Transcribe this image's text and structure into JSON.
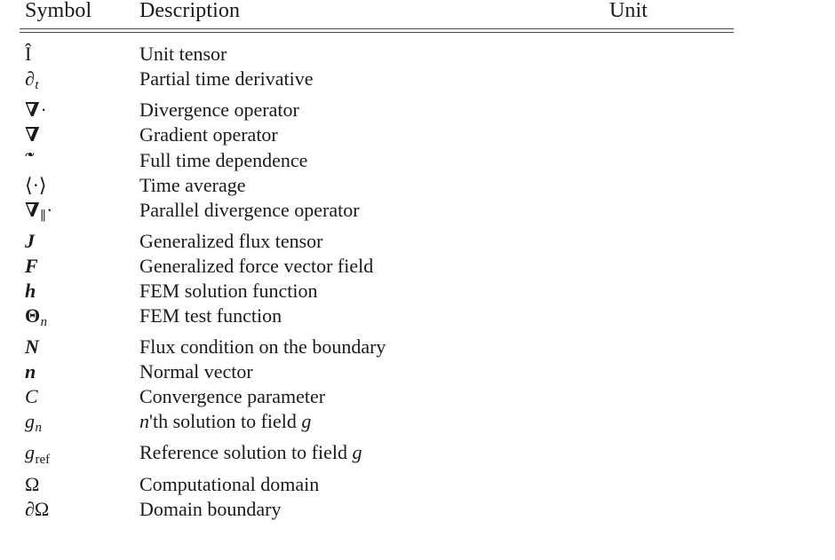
{
  "document": {
    "type": "nomenclature-table",
    "background_color": "#ffffff",
    "text_color": "#1a1a1a",
    "rule_color": "#4a4a4a"
  },
  "table": {
    "headers": {
      "symbol": "Symbol",
      "description": "Description",
      "unit": "Unit"
    },
    "rows": [
      {
        "symbol_text": "Î",
        "description": "Unit tensor",
        "unit": ""
      },
      {
        "symbol_text": "∂t",
        "description": "Partial time derivative",
        "unit": ""
      },
      {
        "symbol_text": "∇·",
        "description": "Divergence operator",
        "unit": ""
      },
      {
        "symbol_text": "∇",
        "description": "Gradient operator",
        "unit": ""
      },
      {
        "symbol_text": "~·",
        "description": "Full time dependence",
        "unit": ""
      },
      {
        "symbol_text": "⟨·⟩",
        "description": "Time average",
        "unit": ""
      },
      {
        "symbol_text": "∇∥·",
        "description": "Parallel divergence operator",
        "unit": ""
      },
      {
        "symbol_text": "J",
        "description": "Generalized flux tensor",
        "unit": ""
      },
      {
        "symbol_text": "F",
        "description": "Generalized force vector field",
        "unit": ""
      },
      {
        "symbol_text": "h",
        "description": "FEM solution function",
        "unit": ""
      },
      {
        "symbol_text": "Θn",
        "description": "FEM test function",
        "unit": ""
      },
      {
        "symbol_text": "N",
        "description": "Flux condition on the boundary",
        "unit": ""
      },
      {
        "symbol_text": "n",
        "description": "Normal vector",
        "unit": ""
      },
      {
        "symbol_text": "C",
        "description": "Convergence parameter",
        "unit": ""
      },
      {
        "symbol_text": "gn",
        "description": "n'th solution to field g",
        "unit": ""
      },
      {
        "symbol_text": "gref",
        "description": "Reference solution to field g",
        "unit": ""
      },
      {
        "symbol_text": "Ω",
        "description": "Computational domain",
        "unit": ""
      },
      {
        "symbol_text": "∂Ω",
        "description": "Domain boundary",
        "unit": ""
      }
    ],
    "description_parts": {
      "row15_pre": "'th solution to field ",
      "row15_italic_n": "n",
      "row15_italic_g": "g",
      "row16_pre": "Reference solution to field ",
      "row16_italic_g": "g"
    },
    "symbol_parts": {
      "partial": "∂",
      "partial_sub_t": "t",
      "nabla": "∇",
      "cdot": "·",
      "parallel_sub": "∥",
      "theta": "Θ",
      "theta_sub_n": "n",
      "g": "g",
      "g_sub_n": "n",
      "g_sub_ref": "ref",
      "omega": "Ω",
      "angle_average": "⟨·⟩",
      "hat_I": "Î",
      "J": "J",
      "F": "F",
      "h": "h",
      "N": "N",
      "n": "n",
      "C": "C"
    }
  }
}
